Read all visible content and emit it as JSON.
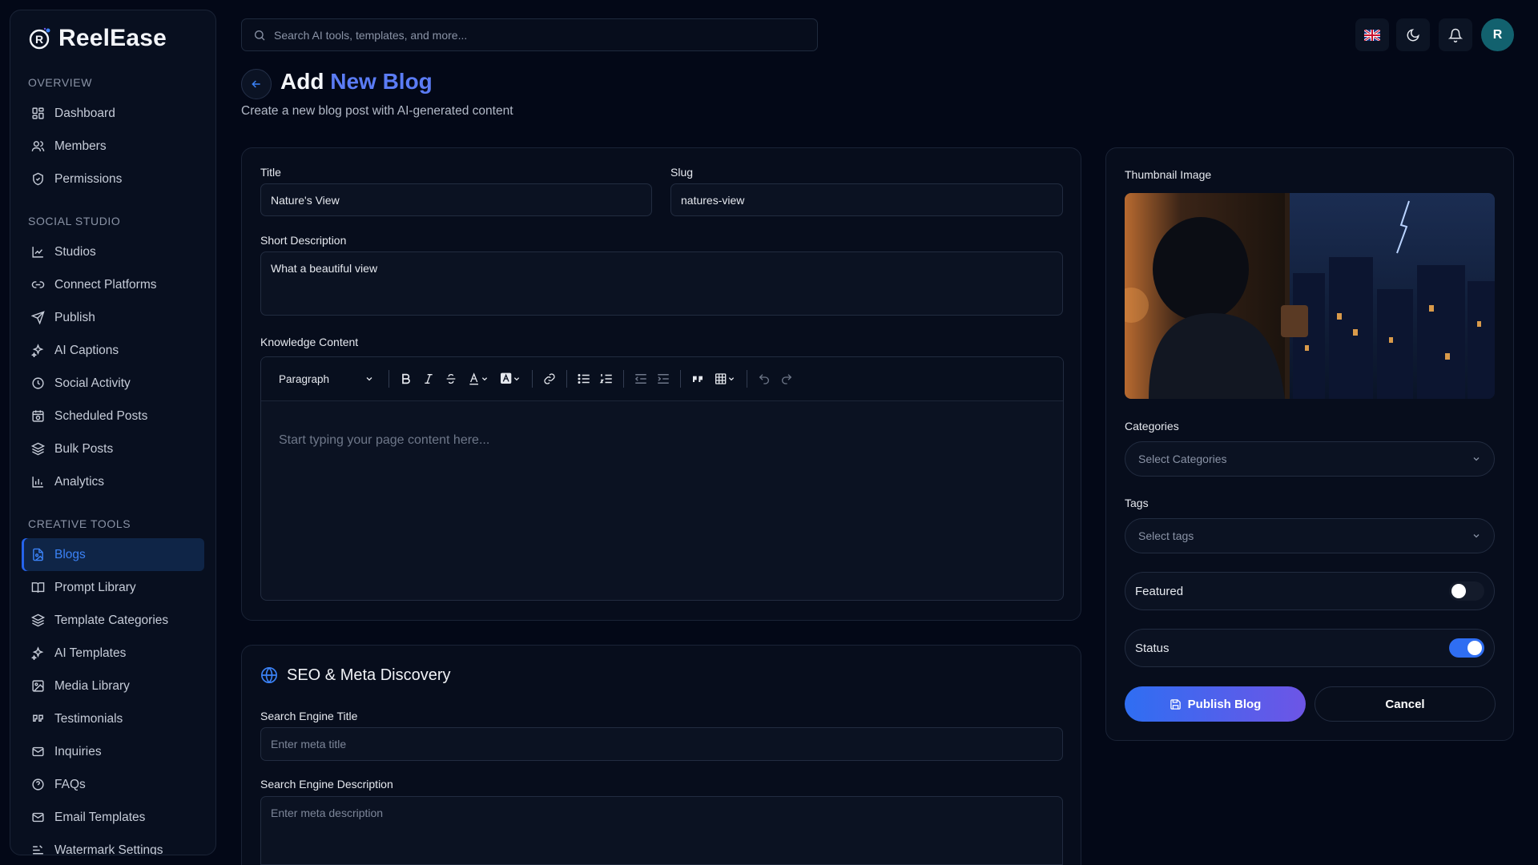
{
  "app": {
    "name": "ReelEase"
  },
  "sidebar": {
    "sections": [
      {
        "title": "OVERVIEW",
        "items": [
          {
            "label": "Dashboard",
            "icon": "dashboard-icon"
          },
          {
            "label": "Members",
            "icon": "users-icon"
          },
          {
            "label": "Permissions",
            "icon": "shield-icon"
          }
        ]
      },
      {
        "title": "SOCIAL STUDIO",
        "items": [
          {
            "label": "Studios",
            "icon": "chart-icon"
          },
          {
            "label": "Connect Platforms",
            "icon": "link-icon"
          },
          {
            "label": "Publish",
            "icon": "send-icon"
          },
          {
            "label": "AI Captions",
            "icon": "sparkles-icon"
          },
          {
            "label": "Social Activity",
            "icon": "clock-icon"
          },
          {
            "label": "Scheduled Posts",
            "icon": "calendar-clock-icon"
          },
          {
            "label": "Bulk Posts",
            "icon": "layers-icon"
          },
          {
            "label": "Analytics",
            "icon": "bar-chart-icon"
          }
        ]
      },
      {
        "title": "CREATIVE TOOLS",
        "items": [
          {
            "label": "Blogs",
            "icon": "file-image-icon",
            "active": true
          },
          {
            "label": "Prompt Library",
            "icon": "book-icon"
          },
          {
            "label": "Template Categories",
            "icon": "layers-icon"
          },
          {
            "label": "AI Templates",
            "icon": "sparkles-icon"
          },
          {
            "label": "Media Library",
            "icon": "image-icon"
          },
          {
            "label": "Testimonials",
            "icon": "quote-icon"
          },
          {
            "label": "Inquiries",
            "icon": "mail-icon"
          },
          {
            "label": "FAQs",
            "icon": "help-circle-icon"
          },
          {
            "label": "Email Templates",
            "icon": "mail-icon"
          },
          {
            "label": "Watermark Settings",
            "icon": "text-icon"
          }
        ]
      }
    ]
  },
  "topbar": {
    "search_placeholder": "Search AI tools, templates, and more...",
    "avatar_initial": "R"
  },
  "page": {
    "title_prefix": "Add",
    "title_accent": "New Blog",
    "subtitle": "Create a new blog post with AI-generated content"
  },
  "form": {
    "title_label": "Title",
    "title_value": "Nature's View",
    "slug_label": "Slug",
    "slug_value": "natures-view",
    "short_desc_label": "Short Description",
    "short_desc_value": "What a beautiful view",
    "content_label": "Knowledge Content",
    "content_placeholder": "Start typing your page content here...",
    "paragraph_select": "Paragraph"
  },
  "seo": {
    "heading": "SEO & Meta Discovery",
    "meta_title_label": "Search Engine Title",
    "meta_title_placeholder": "Enter meta title",
    "meta_desc_label": "Search Engine Description",
    "meta_desc_placeholder": "Enter meta description"
  },
  "side": {
    "thumbnail_label": "Thumbnail Image",
    "categories_label": "Categories",
    "categories_placeholder": "Select Categories",
    "tags_label": "Tags",
    "tags_placeholder": "Select tags",
    "featured_label": "Featured",
    "featured_on": false,
    "status_label": "Status",
    "status_on": true,
    "publish_label": "Publish Blog",
    "cancel_label": "Cancel"
  },
  "colors": {
    "accent": "#2f6ef2",
    "accent_grad_end": "#6d55e6",
    "title_accent": "#5b7cf5",
    "active_nav": "#3b82f6"
  }
}
